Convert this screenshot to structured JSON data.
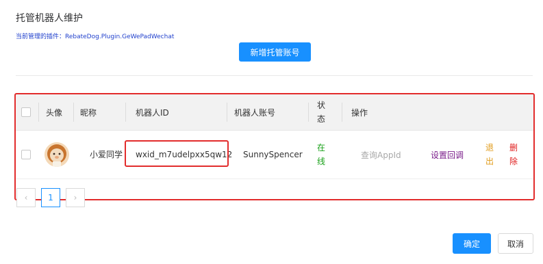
{
  "dialog": {
    "title": "托管机器人维护",
    "plugin_line": "当前管理的插件：RebateDog.Plugin.GeWePadWechat",
    "add_button": "新增托管账号",
    "confirm_button": "确定",
    "cancel_button": "取消"
  },
  "table": {
    "headers": {
      "avatar": "头像",
      "nickname": "昵称",
      "robot_id": "机器人ID",
      "account": "机器人账号",
      "status": "状态",
      "actions": "操作"
    },
    "rows": [
      {
        "nickname": "小爱同学",
        "robot_id": "wxid_m7udelpxx5qw12",
        "account": "SunnySpencer",
        "status": "在线",
        "actions": {
          "query": "查询AppId",
          "callback": "设置回调",
          "logout": "退出",
          "delete": "删除"
        }
      }
    ]
  },
  "pagination": {
    "prev_icon": "chevron-left-icon",
    "current_page": "1",
    "next_icon": "chevron-right-icon"
  },
  "colors": {
    "primary": "#1890ff",
    "highlight": "#e22b2b",
    "online": "#18a018",
    "logout": "#e09a18",
    "delete": "#e02020",
    "callback": "#7a1c8a"
  }
}
